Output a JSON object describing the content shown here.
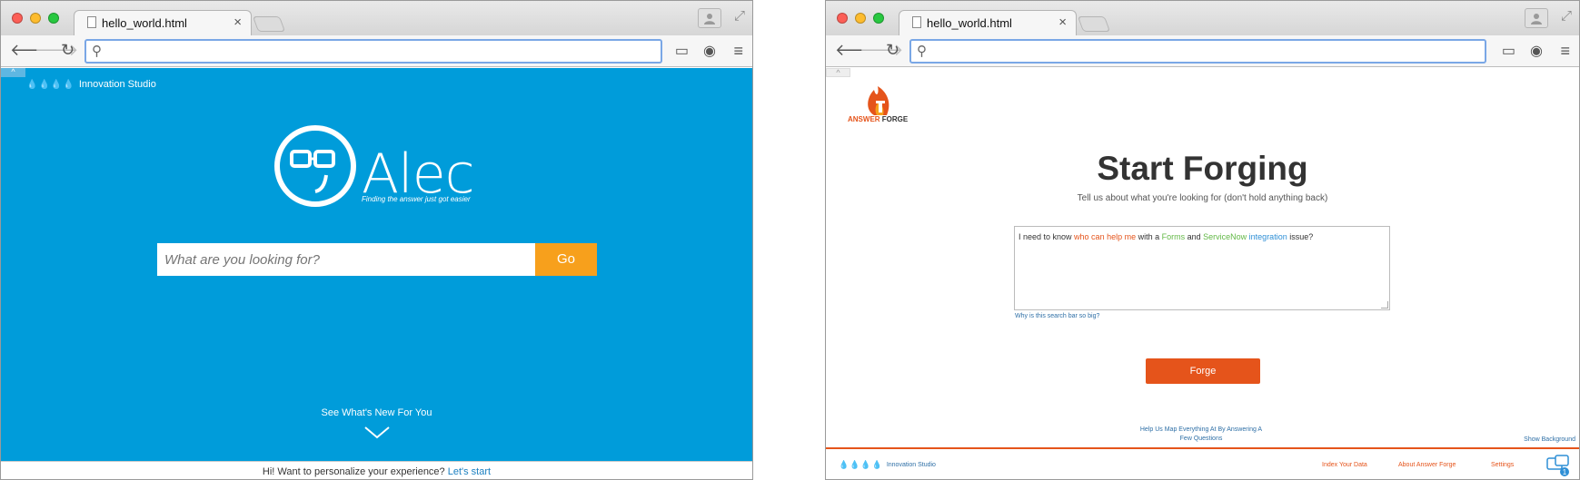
{
  "left_window": {
    "tab_title": "hello_world.html",
    "address": "",
    "brand": "Innovation Studio",
    "logo_name": "Alec",
    "tagline": "Finding the answer just got easier",
    "search_placeholder": "What are you looking for?",
    "go_label": "Go",
    "whats_new": "See What's New For You",
    "personalize_text": "Hi! Want to personalize your experience?",
    "personalize_link": "Let's start",
    "colors": {
      "background": "#009cda",
      "go_button": "#f7a01c"
    }
  },
  "right_window": {
    "tab_title": "hello_world.html",
    "address": "",
    "logo_word_1": "ANSWER",
    "logo_word_2": "FORGE",
    "title": "Start Forging",
    "subtitle": "Tell us about what you're looking for (don't hold anything back)",
    "query": {
      "p1": "I need to know ",
      "p2": "who can help me",
      "p3": " with a ",
      "p4": "Forms",
      "p5": " and ",
      "p6": "ServiceNow",
      "p7": " ",
      "p8": "integration",
      "p9": " issue?"
    },
    "why_link": "Why is this search bar so big?",
    "forge_button": "Forge",
    "help_map": "Help Us Map Everything At By Answering A Few Questions",
    "show_background": "Show Background",
    "footer": {
      "brand": "Innovation Studio",
      "index": "Index Your Data",
      "about": "About Answer Forge",
      "settings": "Settings",
      "chat_badge": "1"
    },
    "colors": {
      "accent": "#e5541b",
      "green": "#62b846",
      "blue": "#2e8fd6"
    }
  },
  "icons": [
    "back-icon",
    "forward-icon",
    "reload-icon",
    "search-icon",
    "cast-icon",
    "extension-icon",
    "menu-icon",
    "profile-icon",
    "fullscreen-icon",
    "file-icon",
    "close-icon",
    "chevron-down-icon",
    "chat-icon"
  ]
}
